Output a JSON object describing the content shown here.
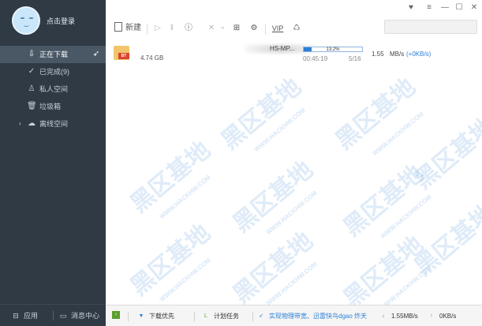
{
  "sidebar": {
    "login_label": "点击登录",
    "items": [
      {
        "label": "正在下载",
        "icon": "download-arrow-icon",
        "active": true
      },
      {
        "label": "已完成(9)",
        "icon": "check-circle-icon",
        "active": false
      },
      {
        "label": "私人空间",
        "icon": "person-icon",
        "active": false
      },
      {
        "label": "垃圾箱",
        "icon": "trash-icon",
        "active": false
      },
      {
        "label": "离线空间",
        "icon": "cloud-folder-icon",
        "active": false
      }
    ],
    "bottom": {
      "apps_label": "应用",
      "messages_label": "消息中心"
    }
  },
  "toolbar": {
    "new_label": "新建",
    "vip_label": "VIP"
  },
  "download": {
    "name_tail": "HS-MP...",
    "size": "4.74 GB",
    "progress_text": "13.2%",
    "progress_fraction": 0.132,
    "time": "00:45:19",
    "pieces": "5/16",
    "speed": "1.55",
    "speed_unit": "MB/s",
    "accel": "(+0KB/s)"
  },
  "statusbar": {
    "priority_label": "下载优先",
    "schedule_label": "计划任务",
    "ad_text": "实现物理带宽、迅雷快鸟dgao 炸天",
    "down_speed": "1.55MB/s",
    "up_speed": "0KB/s"
  },
  "watermark": {
    "text": "黑区基地",
    "url": "WWW.HACKHW.COM"
  },
  "colors": {
    "sidebar_bg": "#2f3a45",
    "accent": "#2d7fd6",
    "progress_border": "#8fb6e0"
  }
}
